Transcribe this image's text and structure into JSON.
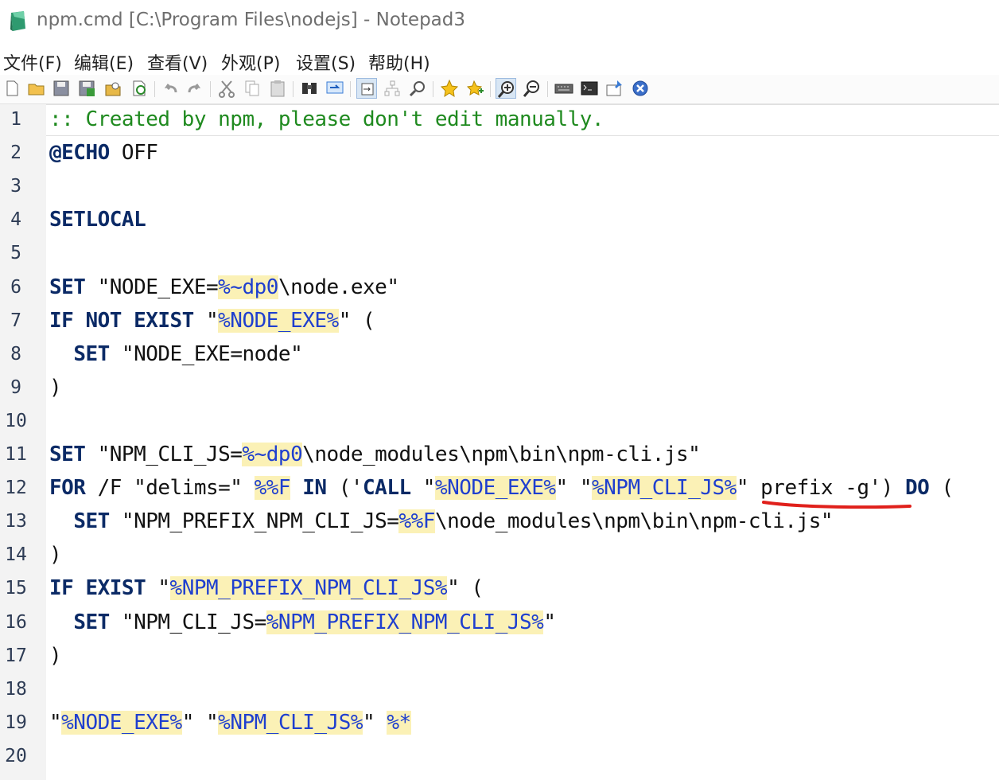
{
  "window": {
    "title": "npm.cmd [C:\\Program Files\\nodejs] - Notepad3",
    "app_icon": "notepad3-icon"
  },
  "menu": [
    "文件(F)",
    "编辑(E)",
    "查看(V)",
    "外观(P)",
    "设置(S)",
    "帮助(H)"
  ],
  "toolbar": [
    "new-file-icon",
    "open-folder-icon",
    "save-icon",
    "save-as-icon",
    "browse-icon",
    "reload-icon",
    "undo-icon",
    "redo-icon",
    "cut-icon",
    "copy-icon",
    "paste-icon",
    "find-icon",
    "replace-icon",
    "word-wrap-icon",
    "tree-icon",
    "zoom-find-icon",
    "favorite-icon",
    "add-favorite-icon",
    "zoom-in-icon",
    "zoom-out-icon",
    "keyboard-icon",
    "terminal-icon",
    "pin-icon",
    "close-icon"
  ],
  "editor": {
    "line_numbers": [
      "1",
      "2",
      "3",
      "4",
      "5",
      "6",
      "7",
      "8",
      "9",
      "10",
      "11",
      "12",
      "13",
      "14",
      "15",
      "16",
      "17",
      "18",
      "19",
      "20"
    ],
    "current_line": 1,
    "lines": [
      [
        {
          "t": ":: Created by npm, please don't edit manually.",
          "c": "comment"
        }
      ],
      [
        {
          "t": "@ECHO",
          "c": "kw"
        },
        {
          "t": " OFF",
          "c": "str"
        }
      ],
      [],
      [
        {
          "t": "SETLOCAL",
          "c": "kw"
        }
      ],
      [],
      [
        {
          "t": "SET",
          "c": "kw"
        },
        {
          "t": " \"NODE_EXE=",
          "c": "str"
        },
        {
          "t": "%~dp0",
          "c": "var"
        },
        {
          "t": "\\node.exe\"",
          "c": "str"
        }
      ],
      [
        {
          "t": "IF NOT EXIST",
          "c": "kw"
        },
        {
          "t": " \"",
          "c": "str"
        },
        {
          "t": "%NODE_EXE%",
          "c": "var"
        },
        {
          "t": "\" (",
          "c": "str"
        }
      ],
      [
        {
          "t": "  ",
          "c": "str"
        },
        {
          "t": "SET",
          "c": "kw"
        },
        {
          "t": " \"NODE_EXE=node\"",
          "c": "str"
        }
      ],
      [
        {
          "t": ")",
          "c": "str"
        }
      ],
      [],
      [
        {
          "t": "SET",
          "c": "kw"
        },
        {
          "t": " \"NPM_CLI_JS=",
          "c": "str"
        },
        {
          "t": "%~dp0",
          "c": "var"
        },
        {
          "t": "\\node_modules\\npm\\bin\\npm-cli.js\"",
          "c": "str"
        }
      ],
      [
        {
          "t": "FOR",
          "c": "kw"
        },
        {
          "t": " /F \"delims=\" ",
          "c": "str"
        },
        {
          "t": "%%F",
          "c": "var"
        },
        {
          "t": " ",
          "c": "str"
        },
        {
          "t": "IN",
          "c": "kw"
        },
        {
          "t": " ('",
          "c": "str"
        },
        {
          "t": "CALL",
          "c": "kw"
        },
        {
          "t": " \"",
          "c": "str"
        },
        {
          "t": "%NODE_EXE%",
          "c": "var"
        },
        {
          "t": "\" \"",
          "c": "str"
        },
        {
          "t": "%NPM_CLI_JS%",
          "c": "var"
        },
        {
          "t": "\" prefix -g') ",
          "c": "str"
        },
        {
          "t": "DO",
          "c": "kw"
        },
        {
          "t": " (",
          "c": "str"
        }
      ],
      [
        {
          "t": "  ",
          "c": "str"
        },
        {
          "t": "SET",
          "c": "kw"
        },
        {
          "t": " \"NPM_PREFIX_NPM_CLI_JS=",
          "c": "str"
        },
        {
          "t": "%%F",
          "c": "var"
        },
        {
          "t": "\\node_modules\\npm\\bin\\npm-cli.js\"",
          "c": "str"
        }
      ],
      [
        {
          "t": ")",
          "c": "str"
        }
      ],
      [
        {
          "t": "IF EXIST",
          "c": "kw"
        },
        {
          "t": " \"",
          "c": "str"
        },
        {
          "t": "%NPM_PREFIX_NPM_CLI_JS%",
          "c": "var"
        },
        {
          "t": "\" (",
          "c": "str"
        }
      ],
      [
        {
          "t": "  ",
          "c": "str"
        },
        {
          "t": "SET",
          "c": "kw"
        },
        {
          "t": " \"NPM_CLI_JS=",
          "c": "str"
        },
        {
          "t": "%NPM_PREFIX_NPM_CLI_JS%",
          "c": "var"
        },
        {
          "t": "\"",
          "c": "str"
        }
      ],
      [
        {
          "t": ")",
          "c": "str"
        }
      ],
      [],
      [
        {
          "t": "\"",
          "c": "str"
        },
        {
          "t": "%NODE_EXE%",
          "c": "var"
        },
        {
          "t": "\" \"",
          "c": "str"
        },
        {
          "t": "%NPM_CLI_JS%",
          "c": "var"
        },
        {
          "t": "\" ",
          "c": "str"
        },
        {
          "t": "%*",
          "c": "var"
        }
      ],
      []
    ]
  },
  "colors": {
    "comment": "#1f8a1f",
    "keyword": "#0b2a66",
    "variable": "#1f3fcf",
    "variable_bg": "#fbf1b6",
    "annotation": "#e0201b"
  }
}
